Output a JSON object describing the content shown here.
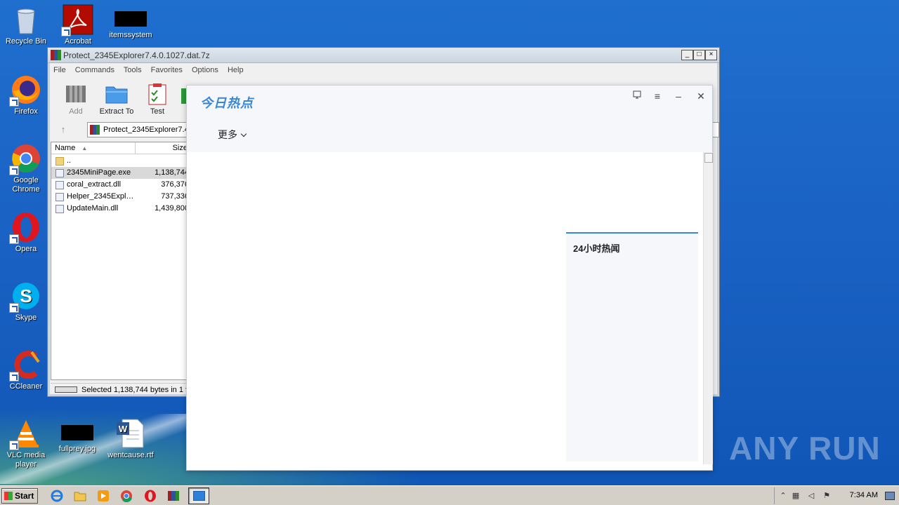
{
  "desktop": {
    "icons": [
      {
        "label": "Recycle Bin"
      },
      {
        "label": "Acrobat"
      },
      {
        "label": "itemssystem"
      },
      {
        "label": "Firefox"
      },
      {
        "label": "Google Chrome"
      },
      {
        "label": "Opera"
      },
      {
        "label": "Skype"
      },
      {
        "label": "CCleaner"
      },
      {
        "label": "VLC media player"
      },
      {
        "label": "fullprey.jpg"
      },
      {
        "label": "wentcause.rtf"
      }
    ]
  },
  "winrar": {
    "title": "Protect_2345Explorer7.4.0.1027.dat.7z",
    "menu": [
      "File",
      "Commands",
      "Tools",
      "Favorites",
      "Options",
      "Help"
    ],
    "toolbar": {
      "add": "Add",
      "extract_to": "Extract To",
      "test": "Test"
    },
    "path": "Protect_2345Explorer7.4",
    "columns": {
      "name": "Name",
      "size": "Size"
    },
    "files": [
      {
        "name": "..",
        "size": ""
      },
      {
        "name": "2345MiniPage.exe",
        "size": "1,138,744"
      },
      {
        "name": "coral_extract.dll",
        "size": "376,376"
      },
      {
        "name": "Helper_2345Expl…",
        "size": "737,336"
      },
      {
        "name": "UpdateMain.dll",
        "size": "1,439,800"
      }
    ],
    "status": "Selected 1,138,744 bytes in 1 f"
  },
  "popup": {
    "brand": "今日热点",
    "more_label": "更多",
    "side_title": "24小时热闻"
  },
  "taskbar": {
    "start_label": "Start",
    "clock": "7:34 AM"
  },
  "watermark": "ANY RUN"
}
